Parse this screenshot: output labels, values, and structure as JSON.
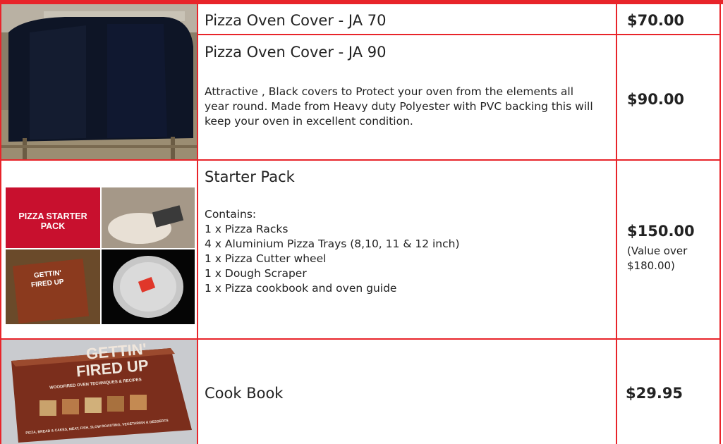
{
  "products": [
    {
      "title": "Pizza Oven Cover - JA 70",
      "price": "$70.00"
    },
    {
      "title": "Pizza Oven Cover - JA 90",
      "description": "Attractive , Black covers to Protect your oven from the elements all year round. Made from Heavy duty Polyester with PVC backing this will keep your oven in excellent condition.",
      "price": "$90.00"
    },
    {
      "title": "Starter Pack",
      "contains_label": "Contains:",
      "items": [
        "1 x Pizza Racks",
        "4 x Aluminium Pizza Trays (8,10, 11 & 12 inch)",
        "1 x Pizza Cutter wheel",
        "1 x Dough Scraper",
        "1 x Pizza cookbook and oven guide"
      ],
      "price": "$150.00",
      "price_note": [
        "(Value over",
        "$180.00)"
      ],
      "image_text": "PIZZA STARTER PACK",
      "book_cover_text": [
        "GETTIN'",
        "FIRED UP"
      ]
    },
    {
      "title": "Cook Book",
      "price": "$29.95",
      "book_cover_text": [
        "GETTIN'",
        "FIRED UP",
        "WOODFIRED OVEN TECHNIQUES & RECIPES",
        "PIZZA, BREAD & CAKES, MEAT, FISH, SLOW ROASTING, VEGETARIAN & DESSERTS"
      ]
    }
  ],
  "colors": {
    "accent": "#e8242a"
  }
}
